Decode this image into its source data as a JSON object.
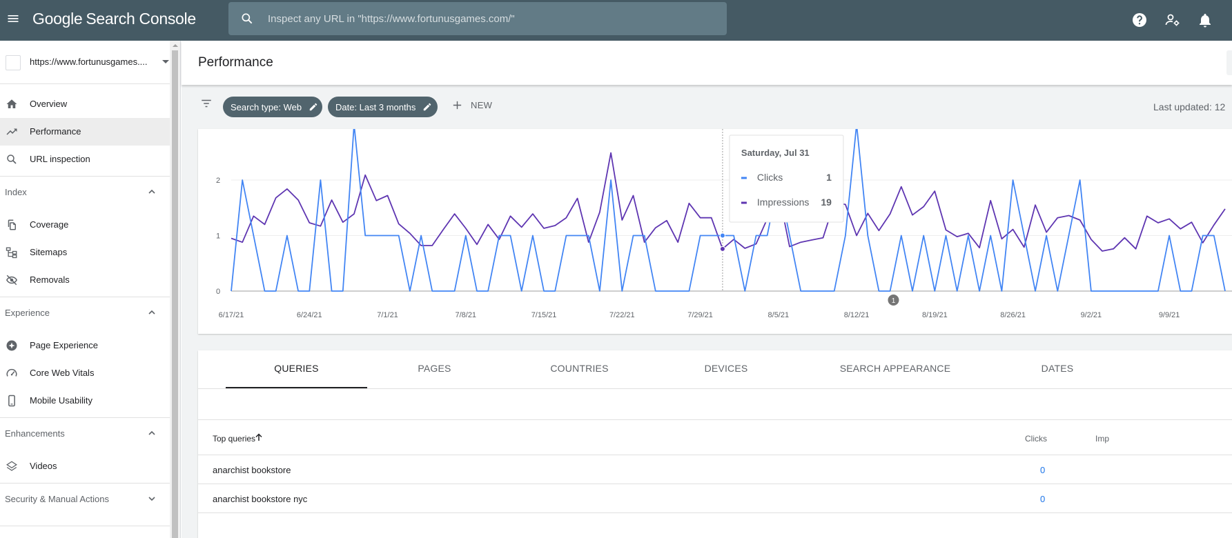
{
  "app": {
    "logo_google": "Google",
    "logo_product": "Search Console",
    "search_placeholder": "Inspect any URL in \"https://www.fortunusgames.com/\"",
    "icons": [
      "menu-icon",
      "search-icon",
      "help-icon",
      "manage-users-icon",
      "notifications-icon"
    ]
  },
  "sidebar": {
    "property": "https://www.fortunusgames....",
    "items_top": [
      {
        "label": "Overview",
        "icon": "home-icon"
      },
      {
        "label": "Performance",
        "icon": "trending-icon",
        "active": true
      },
      {
        "label": "URL inspection",
        "icon": "search-icon"
      }
    ],
    "section_index": "Index",
    "items_index": [
      {
        "label": "Coverage",
        "icon": "coverage-icon"
      },
      {
        "label": "Sitemaps",
        "icon": "sitemap-icon"
      },
      {
        "label": "Removals",
        "icon": "visibility-off-icon"
      }
    ],
    "section_experience": "Experience",
    "items_experience": [
      {
        "label": "Page Experience",
        "icon": "page-experience-icon"
      },
      {
        "label": "Core Web Vitals",
        "icon": "speed-icon"
      },
      {
        "label": "Mobile Usability",
        "icon": "phone-icon"
      }
    ],
    "section_enhancements": "Enhancements",
    "items_enhancements": [
      {
        "label": "Videos",
        "icon": "layers-icon"
      }
    ],
    "section_security": "Security & Manual Actions"
  },
  "header": {
    "title": "Performance"
  },
  "filters": {
    "search_type": "Search type: Web",
    "date": "Date: Last 3 months",
    "new_label": "NEW",
    "last_updated": "Last updated: 12"
  },
  "chart_data": {
    "type": "line",
    "y_ticks": [
      "2",
      "1",
      "0"
    ],
    "x_ticks": [
      "6/17/21",
      "6/24/21",
      "7/1/21",
      "7/8/21",
      "7/15/21",
      "7/22/21",
      "7/29/21",
      "8/5/21",
      "8/12/21",
      "8/19/21",
      "8/26/21",
      "9/2/21",
      "9/9/21"
    ],
    "ylim": [
      0,
      2.5
    ],
    "grid": true,
    "series": [
      {
        "name": "Clicks",
        "color": "#4285f4",
        "values": [
          0,
          2,
          1,
          0,
          0,
          1,
          0,
          0,
          2,
          0,
          0,
          3,
          1,
          1,
          1,
          1,
          0,
          1,
          0,
          0,
          0,
          1,
          0,
          0,
          1,
          1,
          0,
          1,
          0,
          0,
          1,
          1,
          1,
          0,
          2,
          0,
          1,
          1,
          0,
          0,
          0,
          0,
          1,
          1,
          1,
          1,
          0,
          1,
          1,
          2,
          1,
          0,
          0,
          0,
          0,
          1,
          3,
          1,
          0,
          0,
          1,
          0,
          1,
          0,
          1,
          0,
          1,
          0,
          1,
          0,
          2,
          1,
          0,
          1,
          0,
          1,
          2,
          0,
          0,
          0,
          0,
          0,
          0,
          0,
          1,
          0,
          0,
          1,
          1,
          0
        ]
      },
      {
        "name": "Impressions",
        "color": "#5e35b1",
        "values": [
          0.95,
          0.88,
          1.35,
          1.2,
          1.68,
          1.84,
          1.64,
          1.23,
          1.17,
          1.64,
          1.24,
          1.39,
          2.09,
          1.63,
          1.72,
          1.21,
          1.04,
          0.82,
          0.82,
          1.11,
          1.39,
          1.13,
          0.84,
          1.2,
          0.93,
          1.35,
          1.15,
          1.39,
          1.13,
          1.18,
          1.32,
          1.67,
          0.88,
          1.42,
          2.49,
          1.28,
          1.72,
          0.88,
          1.14,
          1.27,
          0.88,
          1.58,
          1.32,
          1.32,
          0.76,
          0.93,
          0.77,
          0.85,
          1.3,
          1.79,
          0.8,
          0.88,
          0.92,
          0.96,
          1.59,
          1.56,
          1.0,
          1.4,
          1.09,
          1.39,
          1.88,
          1.37,
          1.52,
          1.8,
          1.1,
          0.98,
          1.04,
          0.78,
          1.63,
          0.94,
          1.11,
          0.79,
          1.55,
          1.06,
          1.32,
          1.36,
          1.28,
          0.93,
          0.72,
          0.76,
          0.96,
          0.76,
          1.35,
          1.23,
          1.3,
          1.12,
          1.24,
          0.87,
          1.19,
          1.48
        ]
      }
    ],
    "tooltip": {
      "date": "Saturday, Jul 31",
      "rows": [
        {
          "label": "Clicks",
          "value": "1",
          "color": "#4285f4"
        },
        {
          "label": "Impressions",
          "value": "19",
          "color": "#5e35b1"
        }
      ]
    },
    "annotation_badge": "1"
  },
  "tabs": [
    "QUERIES",
    "PAGES",
    "COUNTRIES",
    "DEVICES",
    "SEARCH APPEARANCE",
    "DATES"
  ],
  "table": {
    "col_query": "Top queries",
    "col_clicks": "Clicks",
    "col_impressions": "Imp",
    "rows": [
      {
        "query": "anarchist bookstore",
        "clicks": "0"
      },
      {
        "query": "anarchist bookstore nyc",
        "clicks": "0"
      }
    ]
  }
}
